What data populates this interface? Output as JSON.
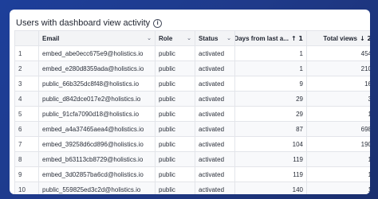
{
  "title": "Users with dashboard view activity",
  "columns": [
    {
      "label": "",
      "kind": "idx"
    },
    {
      "label": "Email",
      "kind": "text",
      "icon": "chevron-down-icon"
    },
    {
      "label": "Role",
      "kind": "text",
      "icon": "chevron-down-icon"
    },
    {
      "label": "Status",
      "kind": "text",
      "icon": "chevron-down-icon"
    },
    {
      "label": "Days from last a...",
      "kind": "num",
      "sort": "↑ 1"
    },
    {
      "label": "Total views",
      "kind": "num",
      "sort": "↓ 2"
    }
  ],
  "rows": [
    [
      "1",
      "embed_abe0ecc675e9@holistics.io",
      "public",
      "activated",
      "1",
      "454"
    ],
    [
      "2",
      "embed_e280d8359ada@holistics.io",
      "public",
      "activated",
      "1",
      "210"
    ],
    [
      "3",
      "public_66b325dc8f48@holistics.io",
      "public",
      "activated",
      "9",
      "16"
    ],
    [
      "4",
      "public_d842dce017e2@holistics.io",
      "public",
      "activated",
      "29",
      "3"
    ],
    [
      "5",
      "public_91cfa7090d18@holistics.io",
      "public",
      "activated",
      "29",
      "1"
    ],
    [
      "6",
      "embed_a4a37465aea4@holistics.io",
      "public",
      "activated",
      "87",
      "698"
    ],
    [
      "7",
      "embed_39258d6cd896@holistics.io",
      "public",
      "activated",
      "104",
      "190"
    ],
    [
      "8",
      "embed_b63113cb8729@holistics.io",
      "public",
      "activated",
      "119",
      "1"
    ],
    [
      "9",
      "embed_3d02857ba6cd@holistics.io",
      "public",
      "activated",
      "119",
      "1"
    ],
    [
      "10",
      "public_559825ed3c2d@holistics.io",
      "public",
      "activated",
      "140",
      "1"
    ]
  ],
  "colors": {
    "background": "#1f3a8a",
    "header_bg": "#f3f4f6"
  }
}
